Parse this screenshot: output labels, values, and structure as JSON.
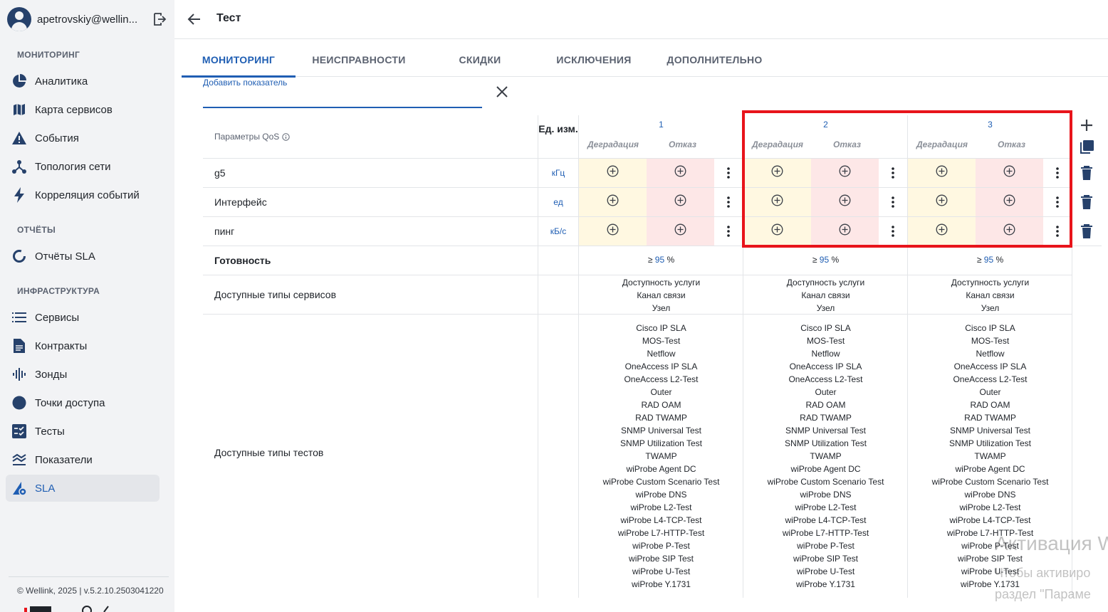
{
  "user": {
    "name": "apetrovskiy@wellin..."
  },
  "sidebar": {
    "sections": [
      {
        "title": "МОНИТОРИНГ",
        "items": [
          {
            "label": "Аналитика",
            "icon": "pie-chart-icon"
          },
          {
            "label": "Карта сервисов",
            "icon": "map-icon"
          },
          {
            "label": "События",
            "icon": "warning-icon"
          },
          {
            "label": "Топология сети",
            "icon": "topology-icon"
          },
          {
            "label": "Корреляция событий",
            "icon": "lightning-icon"
          }
        ]
      },
      {
        "title": "ОТЧЁТЫ",
        "items": [
          {
            "label": "Отчёты SLA",
            "icon": "report-ring-icon"
          }
        ]
      },
      {
        "title": "ИНФРАСТРУКТУРА",
        "items": [
          {
            "label": "Сервисы",
            "icon": "list-icon"
          },
          {
            "label": "Контракты",
            "icon": "document-icon"
          },
          {
            "label": "Зонды",
            "icon": "waveform-icon"
          },
          {
            "label": "Точки доступа",
            "icon": "circle-icon"
          },
          {
            "label": "Тесты",
            "icon": "checklist-icon"
          },
          {
            "label": "Показатели",
            "icon": "metrics-icon"
          },
          {
            "label": "SLA",
            "icon": "sla-gear-icon",
            "active": true
          }
        ]
      }
    ],
    "copyright": "© Wellink, 2025 | v.5.2.10.2503041220"
  },
  "header": {
    "title": "Тест"
  },
  "tabs": [
    {
      "label": "МОНИТОРИНГ",
      "active": true
    },
    {
      "label": "НЕИСПРАВНОСТИ"
    },
    {
      "label": "СКИДКИ"
    },
    {
      "label": "ИСКЛЮЧЕНИЯ"
    },
    {
      "label": "ДОПОЛНИТЕЛЬНО"
    }
  ],
  "add_metric": {
    "label": "Добавить показатель",
    "value": ""
  },
  "table": {
    "qos_header": "Параметры QoS",
    "unit_header": "Ед. изм.",
    "degradation_label": "Деградация",
    "failure_label": "Отказ",
    "columns": [
      {
        "num": "1",
        "ready_prefix": "≥ ",
        "ready_value": "95",
        "ready_suffix": " %"
      },
      {
        "num": "2",
        "ready_prefix": "≥ ",
        "ready_value": "95",
        "ready_suffix": " %"
      },
      {
        "num": "3",
        "ready_prefix": "≥ ",
        "ready_value": "95",
        "ready_suffix": " %"
      }
    ],
    "rows": [
      {
        "label": "g5",
        "unit": "кГц"
      },
      {
        "label": "Интерфейс",
        "unit": "ед"
      },
      {
        "label": "пинг",
        "unit": "кБ/с"
      }
    ],
    "readiness_label": "Готовность",
    "service_types_label": "Доступные типы сервисов",
    "service_types": [
      "Доступность услуги",
      "Канал связи",
      "Узел"
    ],
    "test_types_label": "Доступные типы тестов",
    "test_types": [
      "Cisco IP SLA",
      "MOS-Test",
      "Netflow",
      "OneAccess IP SLA",
      "OneAccess L2-Test",
      "Outer",
      "RAD OAM",
      "RAD TWAMP",
      "SNMP Universal Test",
      "SNMP Utilization Test",
      "TWAMP",
      "wiProbe Agent DC",
      "wiProbe Custom Scenario Test",
      "wiProbe DNS",
      "wiProbe L2-Test",
      "wiProbe L4-TCP-Test",
      "wiProbe L7-HTTP-Test",
      "wiProbe P-Test",
      "wiProbe SIP Test",
      "wiProbe U-Test",
      "wiProbe Y.1731"
    ]
  },
  "colors": {
    "accent": "#1f5eb3",
    "degradation_bg": "#fff8e1",
    "failure_bg": "#fde7e7",
    "highlight": "#e8141b"
  },
  "watermark": {
    "line1": "Активация W",
    "line2": "Чтобы активиро",
    "line3": "раздел \"Параме"
  }
}
